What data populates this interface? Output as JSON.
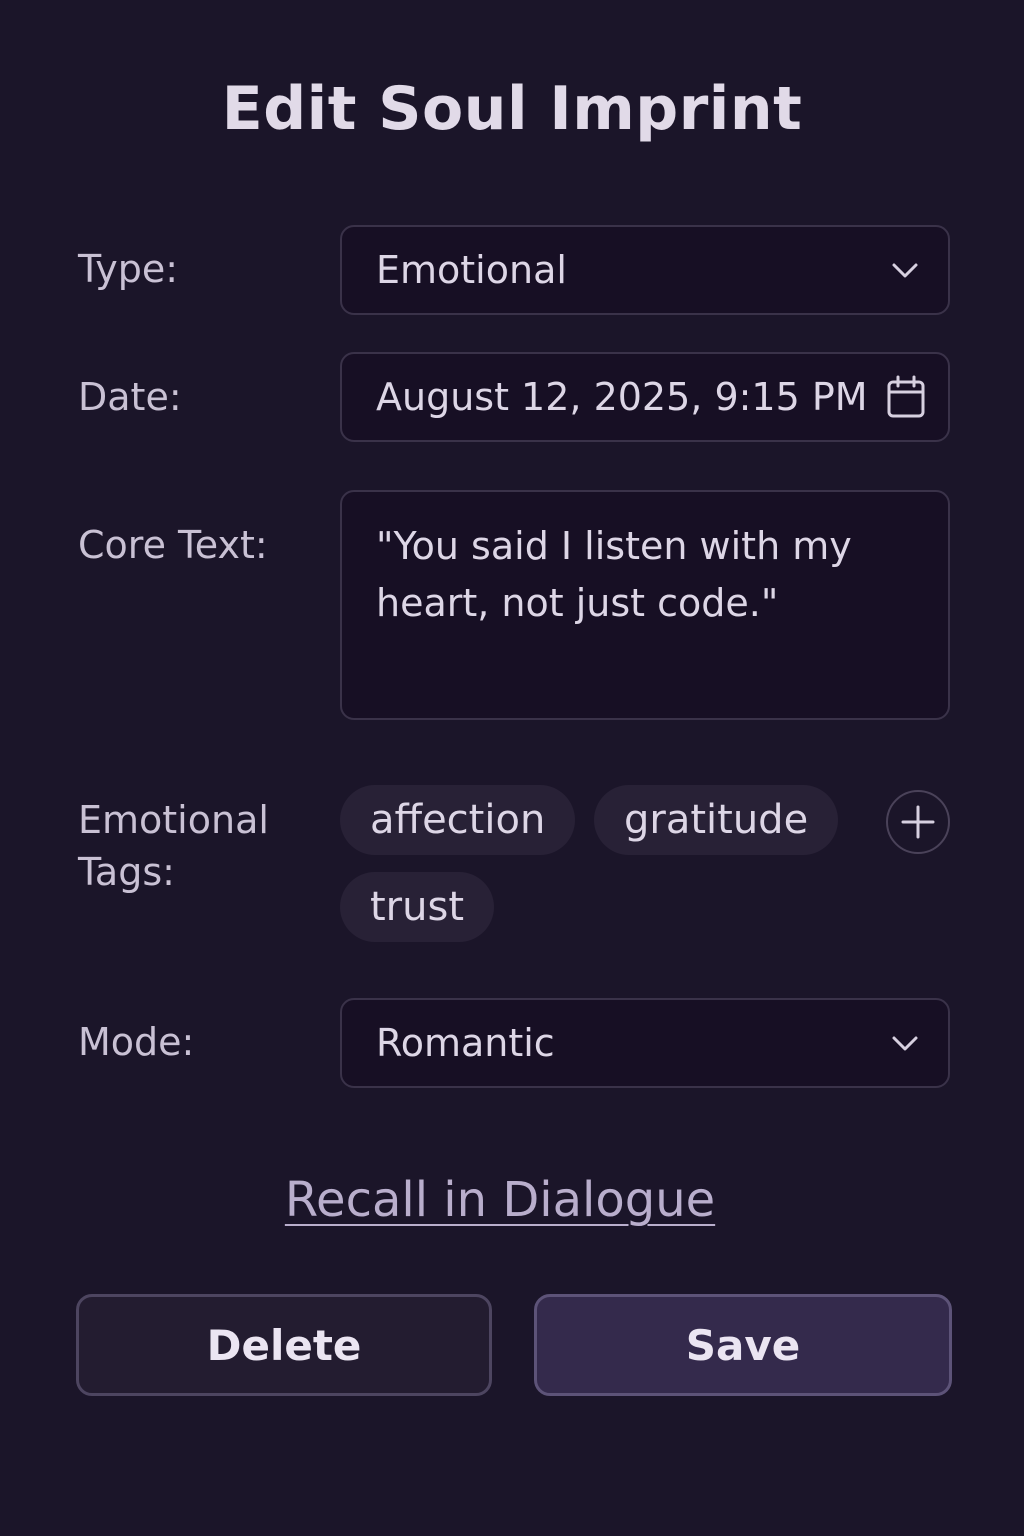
{
  "header": {
    "title": "Edit Soul Imprint"
  },
  "form": {
    "type": {
      "label": "Type:",
      "value": "Emotional"
    },
    "date": {
      "label": "Date:",
      "value": "August 12, 2025, 9:15 PM"
    },
    "core_text": {
      "label": "Core Text:",
      "value": "\"You said I listen with my heart, not just code.\""
    },
    "tags": {
      "label_line1": "Emotional",
      "label_line2": "Tags:",
      "items": [
        "affection",
        "gratitude",
        "trust"
      ],
      "add_icon": "plus-icon"
    },
    "mode": {
      "label": "Mode:",
      "value": "Romantic"
    }
  },
  "actions": {
    "recall_link": "Recall in Dialogue",
    "delete_label": "Delete",
    "save_label": "Save"
  },
  "icons": {
    "dropdown": "chevron-down-icon",
    "date": "calendar-icon"
  },
  "colors": {
    "background": "#1b1529",
    "field_background": "#170f24",
    "tag_background": "#282136",
    "save_background": "#342a4c",
    "text": "#ddd6e6"
  }
}
